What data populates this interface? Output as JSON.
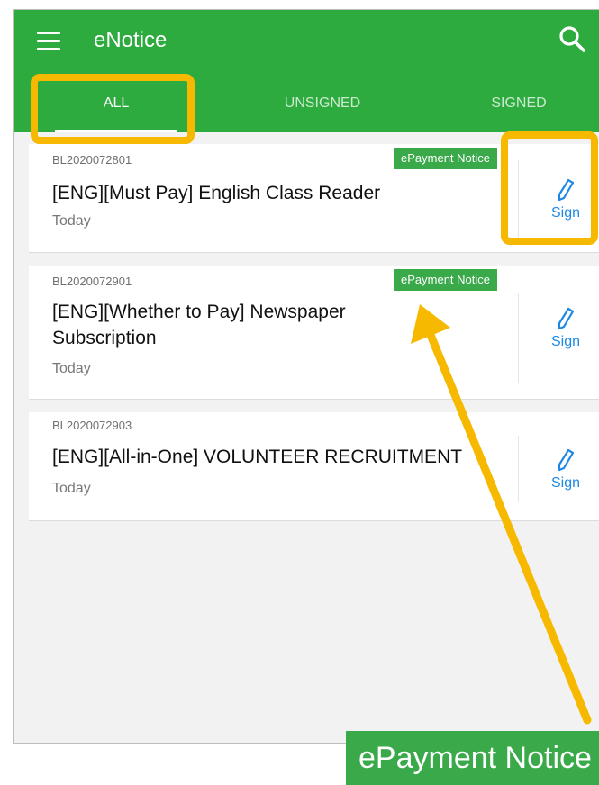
{
  "app": {
    "title": "eNotice"
  },
  "tabs": [
    {
      "label": "ALL",
      "active": true
    },
    {
      "label": "UNSIGNED",
      "active": false
    },
    {
      "label": "SIGNED",
      "active": false
    }
  ],
  "notices": [
    {
      "id": "BL2020072801",
      "badge": "ePayment Notice",
      "title": "[ENG][Must Pay] English Class Reader",
      "date": "Today",
      "action": "Sign"
    },
    {
      "id": "BL2020072901",
      "badge": "ePayment Notice",
      "title": "[ENG][Whether to Pay] Newspaper Subscription",
      "date": "Today",
      "action": "Sign"
    },
    {
      "id": "BL2020072903",
      "badge": "",
      "title": "[ENG][All-in-One] VOLUNTEER RECRUITMENT",
      "date": "Today",
      "action": "Sign"
    }
  ],
  "callout": {
    "zoom_label": "ePayment Notice"
  },
  "colors": {
    "appbar": "#2eab3f",
    "badge": "#3aa94a",
    "accent": "#1e88e5",
    "highlight": "#f7b900"
  },
  "icons": {
    "menu": "hamburger-icon",
    "search": "search-icon",
    "sign": "pencil-icon"
  }
}
